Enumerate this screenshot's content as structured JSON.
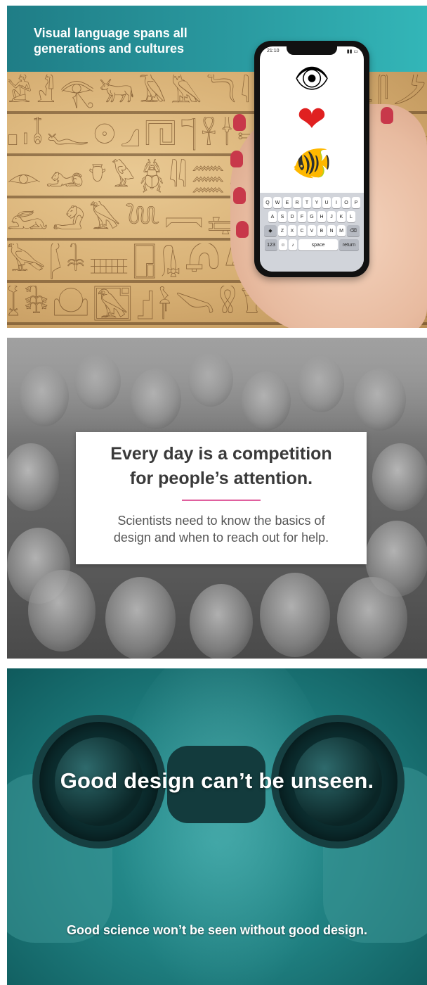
{
  "panel1": {
    "headline": "Visual language spans all generations and cultures",
    "phone": {
      "time": "21:10",
      "emoji": [
        "👁",
        "❤",
        "🐠"
      ],
      "keyboard": {
        "row1": [
          "Q",
          "W",
          "E",
          "R",
          "T",
          "Y",
          "U",
          "I",
          "O",
          "P"
        ],
        "row2": [
          "A",
          "S",
          "D",
          "F",
          "G",
          "H",
          "J",
          "K",
          "L"
        ],
        "row3": [
          "Z",
          "X",
          "C",
          "V",
          "B",
          "N",
          "M"
        ],
        "numbers_key": "123",
        "space_key": "space",
        "return_key": "return"
      }
    }
  },
  "panel2": {
    "title": "Every day is a competition for people’s attention.",
    "title_line1": "Every day is a competition",
    "title_line2": "for people’s attention.",
    "body_line1": "Scientists need to know the basics of",
    "body_line2": "design and when to reach out for help.",
    "accent_color": "#e0609e"
  },
  "panel3": {
    "headline": "Good design can’t be unseen.",
    "subline": "Good science won’t be seen without good design."
  },
  "colors": {
    "teal": "#2a9aa0",
    "teal_dark": "#0f5a5c",
    "stone": "#d9b57e",
    "card_text": "#3a3a3a"
  }
}
